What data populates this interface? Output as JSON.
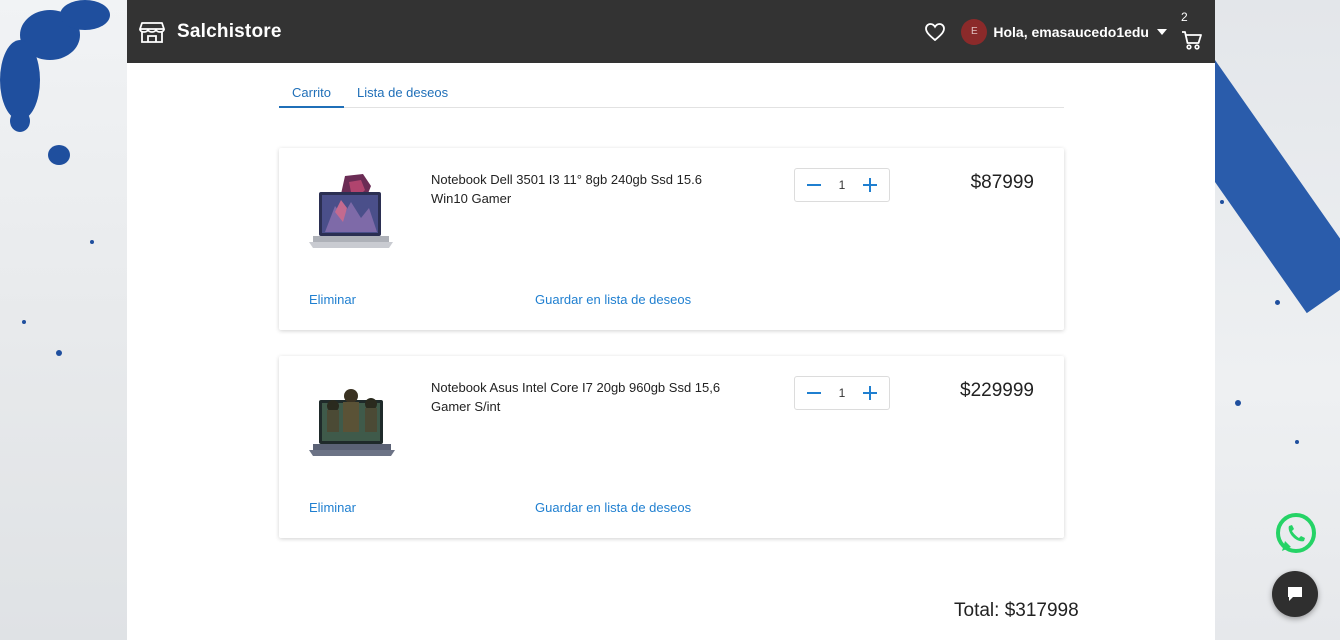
{
  "navbar": {
    "brand": "Salchistore",
    "avatar_initial": "E",
    "greeting": "Hola, emasaucedo1edu",
    "cart_count": "2"
  },
  "tabs": [
    {
      "label": "Carrito",
      "active": true
    },
    {
      "label": "Lista de deseos",
      "active": false
    }
  ],
  "cart": {
    "items": [
      {
        "name": "Notebook Dell 3501 I3 11° 8gb 240gb Ssd 15.6 Win10 Gamer",
        "quantity": "1",
        "price": "$87999",
        "remove_label": "Eliminar",
        "save_label": "Guardar en lista de deseos"
      },
      {
        "name": "Notebook Asus Intel Core I7 20gb 960gb Ssd 15,6 Gamer S/int",
        "quantity": "1",
        "price": "$229999",
        "remove_label": "Eliminar",
        "save_label": "Guardar en lista de deseos"
      }
    ],
    "total": "Total: $317998"
  },
  "colors": {
    "navbar": "#333333",
    "link": "#1f7fd0",
    "whatsapp": "#25d366",
    "chat": "#2f2f2f"
  },
  "icons": [
    "store-icon",
    "heart-icon",
    "chevron-down-icon",
    "cart-icon",
    "minus-icon",
    "plus-icon",
    "whatsapp-icon",
    "chat-icon"
  ]
}
